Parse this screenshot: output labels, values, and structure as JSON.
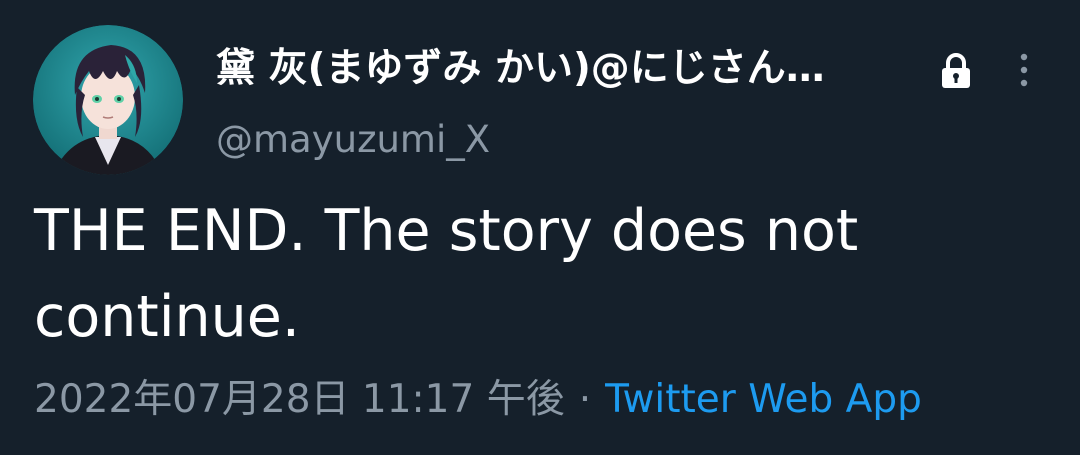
{
  "tweet": {
    "author": {
      "display_name": "黛 灰(まゆずみ かい)@にじさん…",
      "handle": "@mayuzumi_X",
      "avatar_icon": "avatar-image",
      "protected_icon": "lock-icon"
    },
    "menu_icon": "more-vertical-icon",
    "text": "THE END. The story does not continue.",
    "timestamp": "2022年07月28日 11:17 午後",
    "separator": "·",
    "source": "Twitter Web App"
  },
  "colors": {
    "background": "#15202b",
    "primary_text": "#ffffff",
    "secondary_text": "#8b98a5",
    "link": "#1d9bf0"
  }
}
